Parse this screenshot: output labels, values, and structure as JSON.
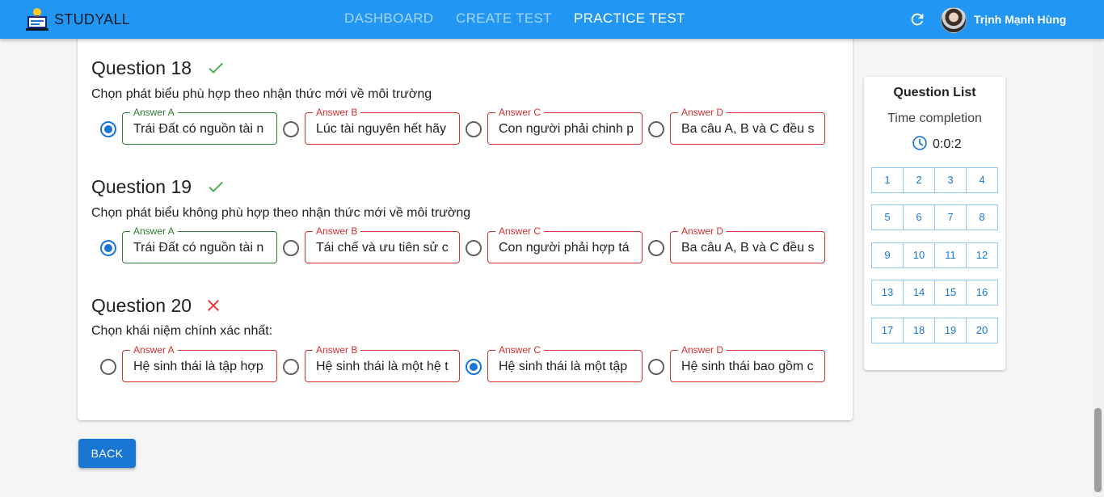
{
  "app": {
    "brand": "STUDYALL",
    "username": "Trịnh Mạnh Hùng"
  },
  "nav": [
    {
      "label": "DASHBOARD",
      "active": false
    },
    {
      "label": "CREATE TEST",
      "active": false
    },
    {
      "label": "PRACTICE TEST",
      "active": true
    }
  ],
  "questions": [
    {
      "title": "Question 18",
      "result": "correct",
      "text": "Chọn phát biểu phù hợp theo nhận thức mới về môi trường",
      "selected": "A",
      "answers": [
        {
          "label": "Answer A",
          "value": "Trái Đất có nguồn tài n",
          "state": "correct"
        },
        {
          "label": "Answer B",
          "value": "Lúc tài nguyên hết hãy",
          "state": "wrong"
        },
        {
          "label": "Answer C",
          "value": "Con người phải chinh p",
          "state": "wrong"
        },
        {
          "label": "Answer D",
          "value": "Ba câu A, B và C đều s",
          "state": "wrong"
        }
      ]
    },
    {
      "title": "Question 19",
      "result": "correct",
      "text": "Chọn phát biểu không phù hợp theo nhận thức mới về môi trường",
      "selected": "A",
      "answers": [
        {
          "label": "Answer A",
          "value": "Trái Đất có nguồn tài n",
          "state": "correct"
        },
        {
          "label": "Answer B",
          "value": "Tái chế và ưu tiên sử c",
          "state": "wrong"
        },
        {
          "label": "Answer C",
          "value": "Con người phải hợp tá",
          "state": "wrong"
        },
        {
          "label": "Answer D",
          "value": "Ba câu A, B và C đều s",
          "state": "wrong"
        }
      ]
    },
    {
      "title": "Question 20",
      "result": "incorrect",
      "text": "Chọn khái niệm chính xác nhất:",
      "selected": "C",
      "answers": [
        {
          "label": "Answer A",
          "value": "Hệ sinh thái là tập hợp",
          "state": "wrong"
        },
        {
          "label": "Answer B",
          "value": "Hệ sinh thái là một hệ t",
          "state": "wrong"
        },
        {
          "label": "Answer C",
          "value": "Hệ sinh thái là một tập",
          "state": "wrong"
        },
        {
          "label": "Answer D",
          "value": "Hệ sinh thái bao gồm c",
          "state": "wrong"
        }
      ]
    }
  ],
  "back_label": "BACK",
  "panel": {
    "title": "Question List",
    "subtitle": "Time completion",
    "time": "0:0:2",
    "numbers": [
      "1",
      "2",
      "3",
      "4",
      "5",
      "6",
      "7",
      "8",
      "9",
      "10",
      "11",
      "12",
      "13",
      "14",
      "15",
      "16",
      "17",
      "18",
      "19",
      "20"
    ]
  },
  "colors": {
    "appbar": "#2196f3",
    "primary": "#1976d2",
    "correct": "#2e7d32",
    "wrong": "#d32f2f",
    "check": "#4caf50",
    "cross": "#e53935"
  },
  "icons": {
    "correct": "check-icon",
    "incorrect": "close-icon",
    "refresh": "refresh-icon",
    "timer": "clock-icon"
  }
}
